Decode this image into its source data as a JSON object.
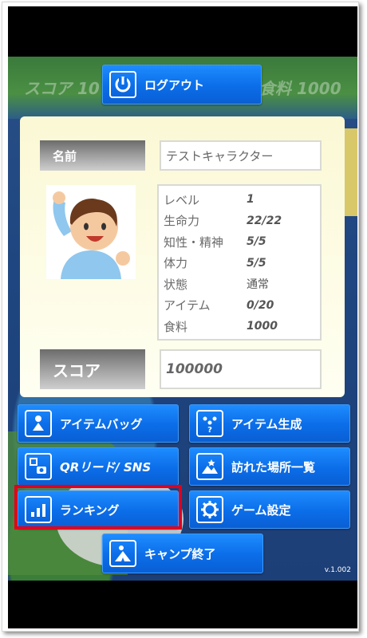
{
  "hud": {
    "score": "スコア 10",
    "food": "食料 1000"
  },
  "logout_label": "ログアウト",
  "profile": {
    "name_label": "名前",
    "name_value": "テストキャラクター",
    "stats": [
      {
        "key": "レベル",
        "value": "1"
      },
      {
        "key": "生命力",
        "value": "22/22"
      },
      {
        "key": "知性・精神",
        "value": "5/5"
      },
      {
        "key": "体力",
        "value": "5/5"
      },
      {
        "key": "状態",
        "value": "通常"
      },
      {
        "key": "アイテム",
        "value": "0/20"
      },
      {
        "key": "食料",
        "value": "1000"
      }
    ],
    "score_label": "スコア",
    "score_value": "100000"
  },
  "menu": {
    "item_bag": "アイテムバッグ",
    "item_create": "アイテム生成",
    "qr_sns": "QRリード/ SNS",
    "visited_places": "訪れた場所一覧",
    "ranking": "ランキング",
    "game_settings": "ゲーム設定",
    "end_camp": "キャンプ終了"
  },
  "version": "v.1.002",
  "colors": {
    "button": "#0b6de8",
    "highlight": "#e2001a",
    "card": "#fbf8d5"
  }
}
